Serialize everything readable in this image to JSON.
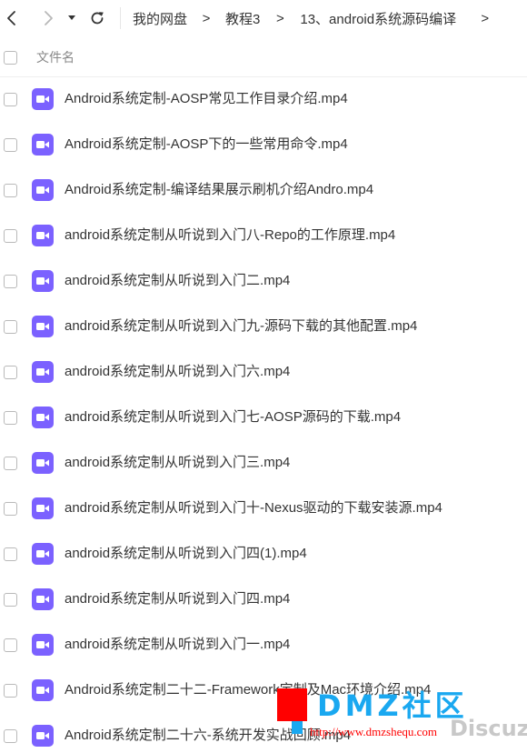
{
  "navbar": {
    "breadcrumb": [
      {
        "label": "我的网盘"
      },
      {
        "label": "教程3"
      },
      {
        "label": "13、android系统源码编译"
      }
    ],
    "separator": ">",
    "trailing_separator": ">"
  },
  "list_header": {
    "column_name": "文件名"
  },
  "files": [
    {
      "name": "Android系统定制-AOSP常见工作目录介绍.mp4",
      "icon": "video-file-icon"
    },
    {
      "name": "Android系统定制-AOSP下的一些常用命令.mp4",
      "icon": "video-file-icon"
    },
    {
      "name": "Android系统定制-编译结果展示刷机介绍Andro.mp4",
      "icon": "video-file-icon"
    },
    {
      "name": "android系统定制从听说到入门八-Repo的工作原理.mp4",
      "icon": "video-file-icon"
    },
    {
      "name": "android系统定制从听说到入门二.mp4",
      "icon": "video-file-icon"
    },
    {
      "name": "android系统定制从听说到入门九-源码下载的其他配置.mp4",
      "icon": "video-file-icon"
    },
    {
      "name": "android系统定制从听说到入门六.mp4",
      "icon": "video-file-icon"
    },
    {
      "name": "android系统定制从听说到入门七-AOSP源码的下载.mp4",
      "icon": "video-file-icon"
    },
    {
      "name": "android系统定制从听说到入门三.mp4",
      "icon": "video-file-icon"
    },
    {
      "name": "android系统定制从听说到入门十-Nexus驱动的下载安装源.mp4",
      "icon": "video-file-icon"
    },
    {
      "name": "android系统定制从听说到入门四(1).mp4",
      "icon": "video-file-icon"
    },
    {
      "name": "android系统定制从听说到入门四.mp4",
      "icon": "video-file-icon"
    },
    {
      "name": "android系统定制从听说到入门一.mp4",
      "icon": "video-file-icon"
    },
    {
      "name": "Android系统定制二十二-Framework定制及Mac环境介绍.mp4",
      "icon": "video-file-icon"
    },
    {
      "name": "Android系统定制二十六-系统开发实战回顾.mp4",
      "icon": "video-file-icon"
    }
  ],
  "watermark": {
    "logo_text": "DMZ社区",
    "url": "http://www.dmzshequ.com",
    "brand": "Discuz!"
  },
  "colors": {
    "video_icon": "#7b61ff",
    "watermark_blue": "#1aa8f0",
    "watermark_red": "#ff0000"
  }
}
